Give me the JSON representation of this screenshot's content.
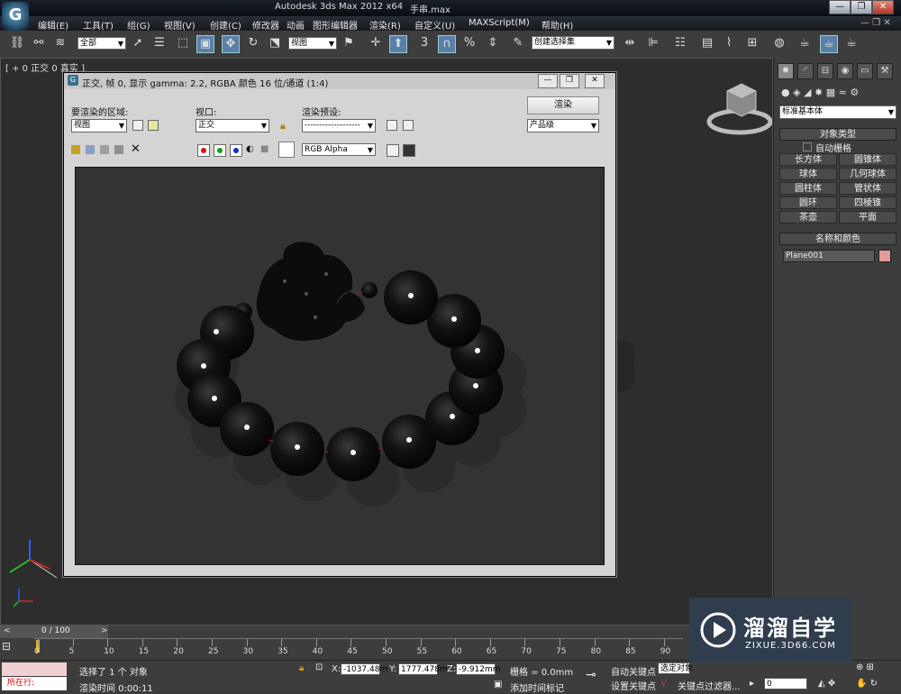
{
  "window": {
    "app_title": "Autodesk 3ds Max  2012 x64",
    "file_name": "手串.max",
    "logo": "G"
  },
  "menu": [
    "编辑(E)",
    "工具(T)",
    "组(G)",
    "视图(V)",
    "创建(C)",
    "修改器",
    "动画",
    "图形编辑器",
    "渲染(R)",
    "自定义(U)",
    "MAXScript(M)",
    "帮助(H)"
  ],
  "toolbar": {
    "selection_filter": "全部",
    "ref_coord": "视图",
    "selection_set": "创建选择集"
  },
  "viewport": {
    "label": "[ + 0 正交 0 真实 ]"
  },
  "render_window": {
    "title": "正交, 帧 0, 显示 gamma: 2.2, RGBA 颜色 16 位/通道 (1:4)",
    "area_label": "要渲染的区域:",
    "area_value": "视图",
    "viewport_label": "视口:",
    "viewport_value": "正交",
    "preset_label": "渲染预设:",
    "preset_value": "-------------------",
    "render_button": "渲染",
    "quality_value": "产品级",
    "channel_value": "RGB Alpha"
  },
  "command_panel": {
    "category": "标准基本体",
    "object_type_header": "对象类型",
    "autogrid": "自动栅格",
    "buttons": [
      "长方体",
      "圆锥体",
      "球体",
      "几何球体",
      "圆柱体",
      "管状体",
      "圆环",
      "四棱锥",
      "茶壶",
      "平面"
    ],
    "name_color_header": "名称和颜色",
    "object_name": "Plane001",
    "object_color": "#e39a9a"
  },
  "timeline": {
    "frame_counter": "0 / 100",
    "ticks": [
      "0",
      "5",
      "10",
      "15",
      "20",
      "25",
      "30",
      "35",
      "40",
      "45",
      "50",
      "55",
      "60",
      "65",
      "70",
      "75",
      "80",
      "85",
      "90"
    ]
  },
  "status": {
    "mode_label": "所在行:",
    "selection_info": "选择了 1 个 对象",
    "render_time": "渲染时间  0:00:11",
    "x_label": "X:",
    "x_value": "-1037.48m",
    "y_label": "Y:",
    "y_value": "1777.478m",
    "z_label": "Z:",
    "z_value": "-9.912mm",
    "grid": "栅格 = 0.0mm",
    "add_time_tag": "添加时间标记",
    "auto_key": "自动关键点",
    "set_key": "设置关键点",
    "selected": "选定对象",
    "key_filters": "关键点过滤器...",
    "frame_field": "0"
  },
  "watermark": {
    "brand": "溜溜自学",
    "url": "ZIXUE.3D66.COM"
  },
  "colors": {
    "titlebar": "#0a0c10",
    "panel": "#3d3d3d",
    "accent": "#5a7fa8"
  }
}
